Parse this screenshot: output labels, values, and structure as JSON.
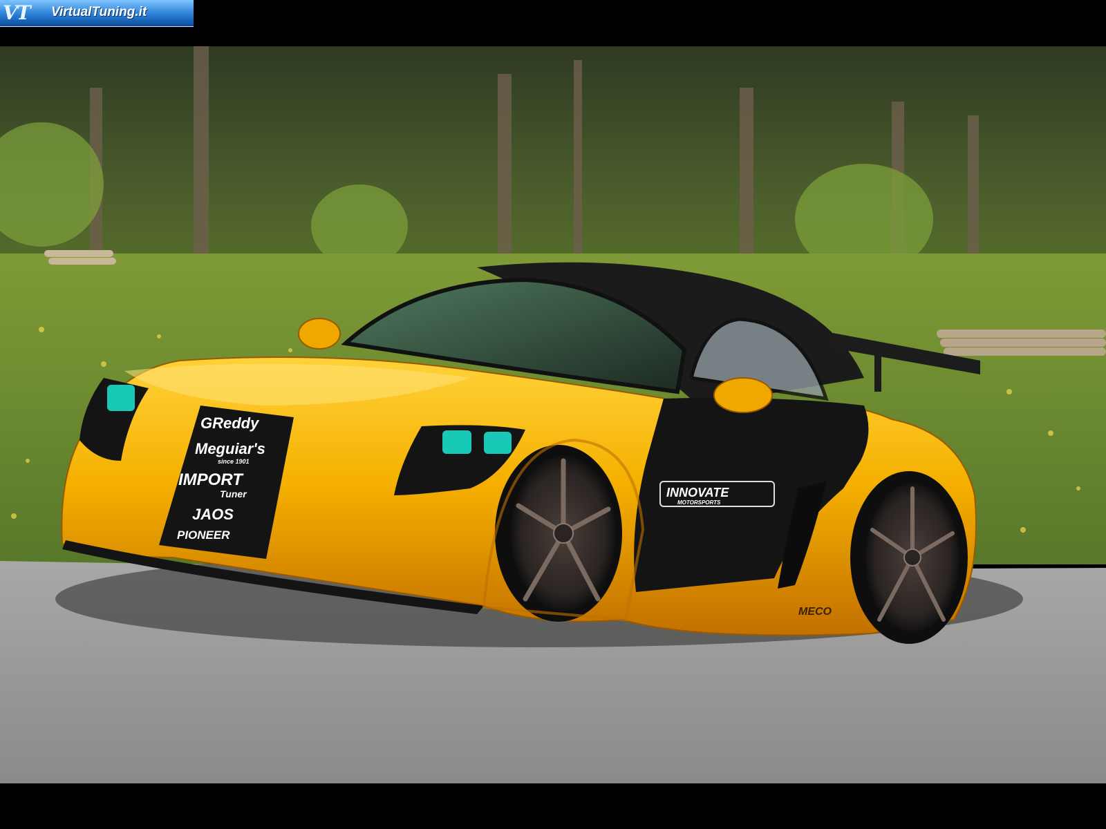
{
  "watermark": {
    "mark": "VT",
    "site": "VirtualTuning.it"
  },
  "photo": {
    "subject": "yellow tuned roadster",
    "colors": {
      "body": "#f2b400",
      "body_shadow": "#c97a00",
      "carbon": "#141414",
      "top": "#1b1b1b",
      "lights": "#19c9b8",
      "grass": "#7c9a2e",
      "trees": "#3b4a24",
      "road": "#9a9a98"
    },
    "decals": {
      "sponsor_1": "GReddy",
      "sponsor_2": "Meguiar's",
      "sponsor_2_sub": "since 1901",
      "sponsor_3": "IMPORT",
      "sponsor_3_sub": "Tuner",
      "sponsor_4": "JAOS",
      "sponsor_5": "PIONEER",
      "side": "INNOVATE",
      "side_sub": "MOTORSPORTS",
      "rear": "MECO"
    }
  }
}
